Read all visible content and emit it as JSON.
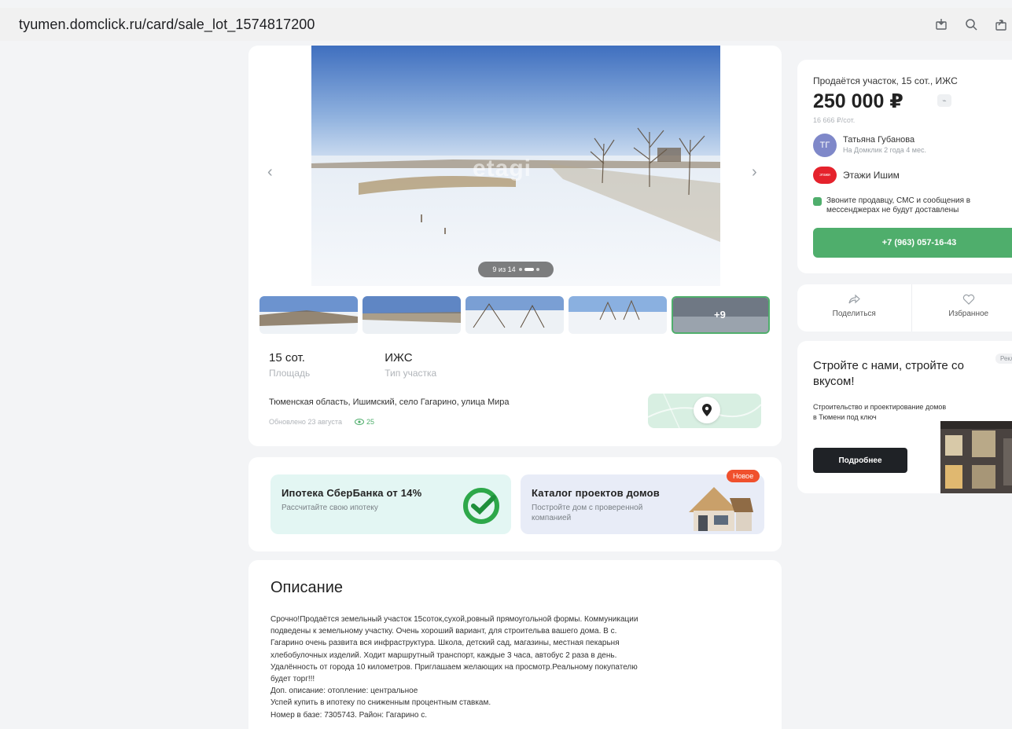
{
  "browser": {
    "url": "tyumen.domclick.ru/card/sale_lot_1574817200"
  },
  "gallery": {
    "watermark": "etagi",
    "counter": "9 из 14",
    "more_label": "+9"
  },
  "specs": [
    {
      "value": "15 сот.",
      "label": "Площадь"
    },
    {
      "value": "ИЖС",
      "label": "Тип участка"
    }
  ],
  "address": "Тюменская область, Ишимский, село Гагарино, улица Мира",
  "updated": "Обновлено 23 августа",
  "views": "25",
  "promos": {
    "mortgage_title": "Ипотека СберБанка от 14%",
    "mortgage_sub": "Рассчитайте свою ипотеку",
    "catalog_title": "Каталог проектов домов",
    "catalog_sub": "Постройте дом с проверенной компанией",
    "new_badge": "Новое"
  },
  "description": {
    "title": "Описание",
    "lines": [
      "Срочно!Продаётся земельный участок 15соток,сухой,ровный прямоугольной формы. Коммуникации",
      "подведены к земельному участку. Очень хороший вариант, для строительва вашего дома. В с.",
      "Гагарино очень развита вся инфраструктура. Школа, детский сад, магазины, местная пекарьня",
      "хлебобулочных изделий. Ходит маршрутный транспорт, каждые 3 часа, автобус 2 раза в день.",
      "Удалённость от города 10 километров. Приглашаем желающих на просмотр.Реальному покупателю",
      "будет торг!!!",
      "Доп. описание: отопление: центральное",
      "Успей купить в ипотеку по сниженным процентным ставкам.",
      "Номер в базе: 7305743. Район: Гагарино с."
    ]
  },
  "offer": {
    "title": "Продаётся участок, 15 сот., ИЖС",
    "price": "250 000 ₽",
    "per_unit": "16 666 ₽/сот.",
    "agent_initials": "ТГ",
    "agent_name": "Татьяна Губанова",
    "agent_since": "На Домклик 2 года 4 мес.",
    "agency_logo": "этажи",
    "agency_name": "Этажи Ишим",
    "notice": "Звоните продавцу, СМС и сообщения в мессенджерах не будут доставлены",
    "phone": "+7 (963) 057-16-43"
  },
  "actions": {
    "share": "Поделиться",
    "favorite": "Избранное"
  },
  "ad": {
    "badge": "Реклама",
    "title": "Стройте с нами, стройте со вкусом!",
    "subtitle": "Строительство и проектирование домов в Тюмени под ключ",
    "button": "Подробнее"
  },
  "colors": {
    "accent_green": "#4fae6c",
    "badge_red": "#f0502d",
    "dark_button": "#1f2226"
  }
}
